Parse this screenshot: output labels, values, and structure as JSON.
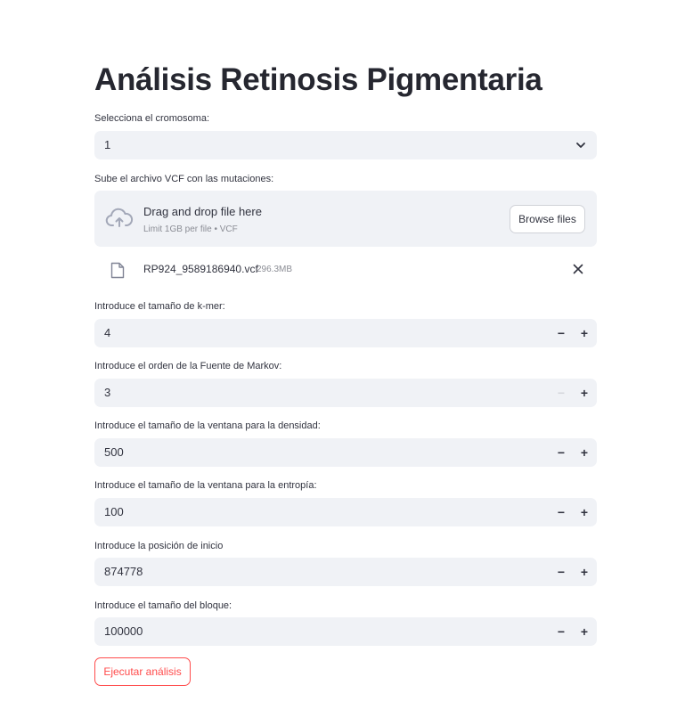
{
  "page_title": "Análisis Retinosis Pigmentaria",
  "chromosome": {
    "label": "Selecciona el cromosoma:",
    "selected": "1"
  },
  "uploader": {
    "label": "Sube el archivo VCF con las mutaciones:",
    "drop_text": "Drag and drop file here",
    "limit_text": "Limit 1GB per file • VCF",
    "browse_label": "Browse files",
    "file": {
      "name": "RP924_9589186940.vcf",
      "size": "296.3MB"
    }
  },
  "inputs": {
    "kmer": {
      "label": "Introduce el tamaño de k-mer:",
      "value": "4"
    },
    "markov": {
      "label": "Introduce el orden de la Fuente de Markov:",
      "value": "3"
    },
    "density_window": {
      "label": "Introduce el tamaño de la ventana para la densidad:",
      "value": "500"
    },
    "entropy_window": {
      "label": "Introduce el tamaño de la ventana para la entropía:",
      "value": "100"
    },
    "start_position": {
      "label": "Introduce la posición de inicio",
      "value": "874778"
    },
    "block_size": {
      "label": "Introduce el tamaño del bloque:",
      "value": "100000"
    }
  },
  "stepper": {
    "minus": "−",
    "plus": "+"
  },
  "run_button": "Ejecutar análisis",
  "colors": {
    "accent": "#ff4b4b",
    "field_bg": "#f0f2f6",
    "text": "#31333f",
    "muted": "#8b8d95"
  },
  "icons": {
    "select": "chevron-down-icon",
    "upload": "cloud-upload-icon",
    "file": "file-icon",
    "remove": "close-icon"
  }
}
